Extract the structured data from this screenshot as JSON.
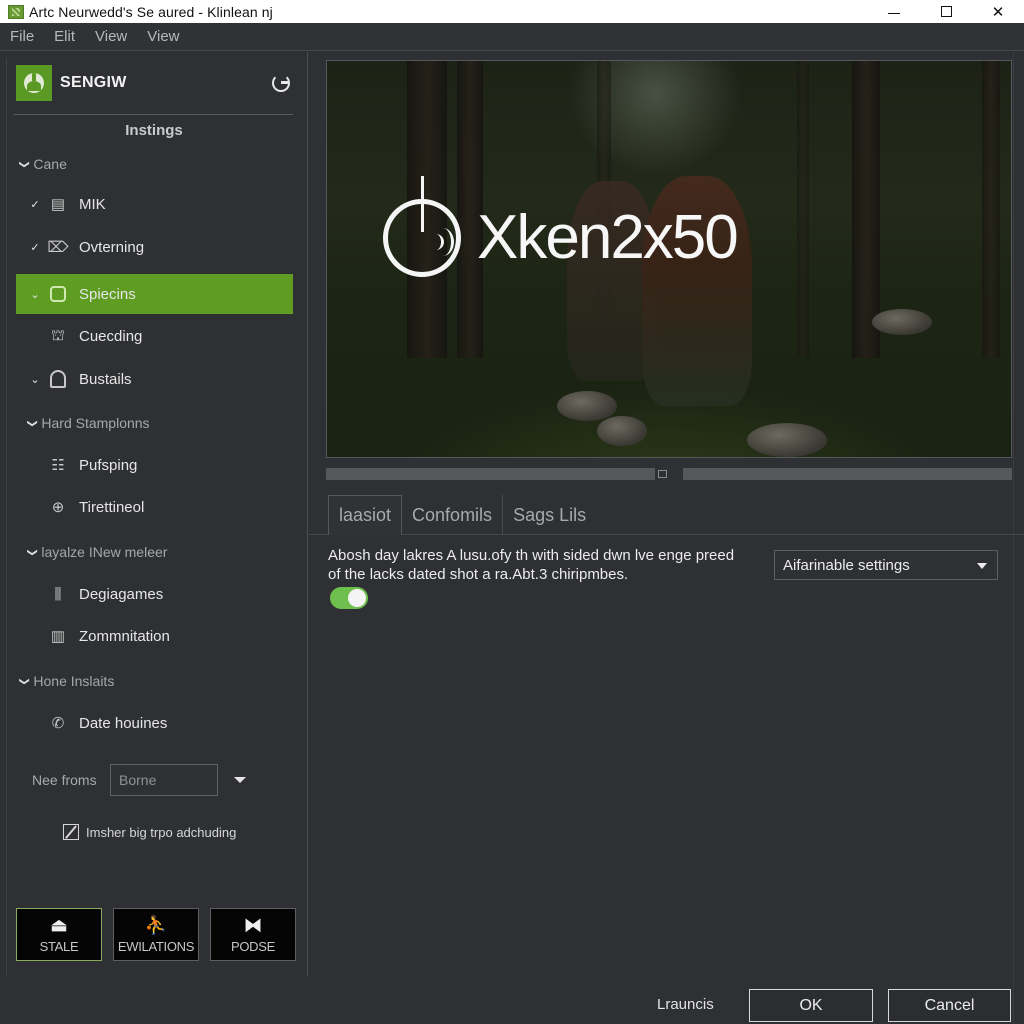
{
  "window": {
    "title": "Artc Neurwedd's Se aured - Klinlean nj",
    "controls": {
      "minimize": "minimize",
      "maximize": "maximize",
      "close": "✕"
    }
  },
  "menu": [
    "File",
    "Elit",
    "View",
    "View"
  ],
  "sidebar": {
    "brand_name": "SENGIW",
    "heading": "Instings",
    "groups": [
      {
        "label": "Cane"
      },
      {
        "label": "Hard Stamplonns"
      },
      {
        "label": "layalze INew meleer"
      },
      {
        "label": "Hone Inslaits"
      }
    ],
    "items": [
      {
        "label": "MIK",
        "icon": "server-icon",
        "glyph": "▤",
        "chevron": "✓"
      },
      {
        "label": "Ovterning",
        "icon": "tag-icon",
        "glyph": "⌦",
        "chevron": "✓"
      },
      {
        "label": "Spiecins",
        "icon": "frame-icon",
        "glyph": "",
        "chevron": "⌄",
        "active": true
      },
      {
        "label": "Cuecding",
        "icon": "robot-icon",
        "glyph": "⛫",
        "chevron": ""
      },
      {
        "label": "Bustails",
        "icon": "arch-icon",
        "glyph": "",
        "chevron": "⌄"
      },
      {
        "label": "Pufsping",
        "icon": "grid-list-icon",
        "glyph": "☷",
        "chevron": ""
      },
      {
        "label": "Tirettineol",
        "icon": "mouse-icon",
        "glyph": "⊕",
        "chevron": ""
      },
      {
        "label": "Degiagames",
        "icon": "pillar-icon",
        "glyph": "⫼",
        "chevron": ""
      },
      {
        "label": "Zommnitation",
        "icon": "document-icon",
        "glyph": "▥",
        "chevron": ""
      },
      {
        "label": "Date houines",
        "icon": "phone-icon",
        "glyph": "✆",
        "chevron": ""
      }
    ],
    "form": {
      "label": "Nee froms",
      "value": "Borne"
    },
    "checkbox": {
      "label": "Imsher big trpo adchuding",
      "checked": true
    },
    "modes": [
      {
        "label": "STALE",
        "glyph": "⏏",
        "icon": "stand-icon",
        "selected": true
      },
      {
        "label": "EWILATIONS",
        "glyph": "⛹",
        "icon": "athlete-icon",
        "selected": false
      },
      {
        "label": "PODSE",
        "glyph": "⧓",
        "icon": "bowtie-icon",
        "selected": false
      }
    ]
  },
  "main": {
    "hero": {
      "wordmark": "Xken2x50"
    },
    "tabs": [
      {
        "label": "laasiot",
        "active": true
      },
      {
        "label": "Confomils",
        "active": false
      },
      {
        "label": "Sags Lils",
        "active": false
      }
    ],
    "description": "Abosh day lakres A lusu.ofy th with sided dwn lve enge preed of the lacks dated shot a ra.Abt.3 chiripmbes.",
    "toggle_on": true,
    "select_value": "Aifarinable settings",
    "footer": {
      "link": "Lrauncis",
      "ok": "OK",
      "cancel": "Cancel"
    }
  },
  "colors": {
    "accent": "#5f9c22",
    "toggle": "#6fbf4f",
    "background": "#2e3033"
  }
}
